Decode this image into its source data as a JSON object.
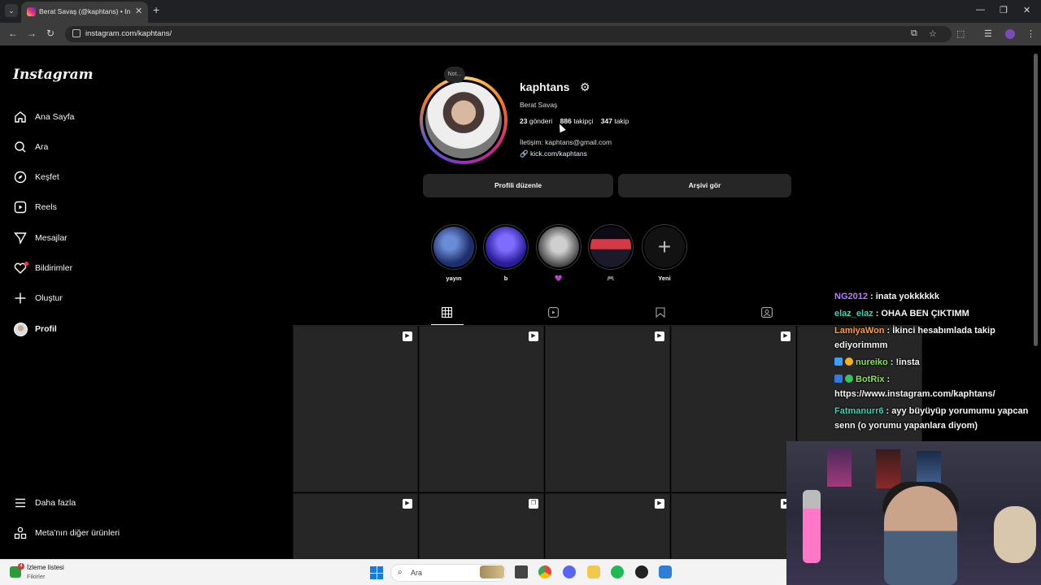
{
  "browser": {
    "tab_title": "Berat Savaş (@kaphtans) • Insta",
    "url": "instagram.com/kaphtans/"
  },
  "instagram": {
    "logo": "Instagram",
    "nav": {
      "home": "Ana Sayfa",
      "search": "Ara",
      "explore": "Keşfet",
      "reels": "Reels",
      "messages": "Mesajlar",
      "notifications": "Bildirimler",
      "create": "Oluştur",
      "profile": "Profil",
      "more": "Daha fazla",
      "meta": "Meta'nın diğer ürünleri"
    },
    "profile": {
      "note": "Not...",
      "username": "kaphtans",
      "full_name": "Berat Savaş",
      "posts_count": "23",
      "posts_label": "gönderi",
      "followers_count": "886",
      "followers_label": "takipçi",
      "following_count": "347",
      "following_label": "takip",
      "contact": "İletişim: kaphtans@gmail.com",
      "link": "kick.com/kaphtans",
      "edit_button": "Profili düzenle",
      "archive_button": "Arşivi gör"
    },
    "highlights": [
      {
        "label": "yayın",
        "color": "#2a3f8f"
      },
      {
        "label": "b",
        "color": "#3a2bd6"
      },
      {
        "label": "💜",
        "color": "#777777"
      },
      {
        "label": "🎮",
        "color": "#c43040"
      },
      {
        "label": "Yeni",
        "color": "#000000"
      }
    ]
  },
  "chat": [
    {
      "name": "NG2012",
      "color": "#b57bff",
      "message": ": inata yokkkkkk"
    },
    {
      "name": "elaz_elaz",
      "color": "#3fd1b5",
      "message": ": OHAA BEN ÇIKTIMM"
    },
    {
      "name": "LamiyaWon",
      "color": "#ff9d3f",
      "message": ": İkinci hesabımlada takip ediyorimmm"
    },
    {
      "name": "nureiko",
      "color": "#8be05a",
      "message": ": !insta"
    },
    {
      "name": "BotRix",
      "color": "#8be05a",
      "message": ": https://www.instagram.com/kaphtans/"
    },
    {
      "name": "Fatmanurr6",
      "color": "#3fd1b5",
      "message": ": ayy büyüyüp yorumumu yapcan senn (o yorumu yapanlara diyom)"
    }
  ],
  "taskbar": {
    "watch_title": "İzleme listesi",
    "watch_sub": "Fikirler",
    "watch_badge": "4",
    "search_placeholder": "Ara"
  }
}
